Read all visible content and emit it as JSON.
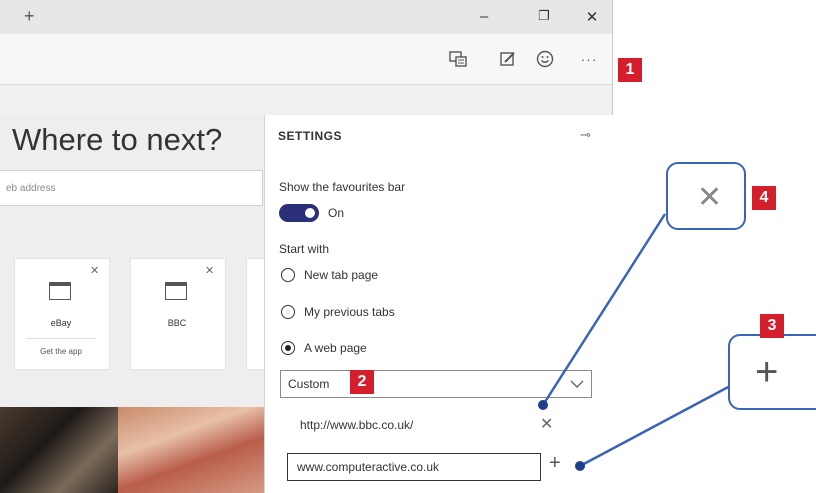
{
  "window": {
    "title_add": "+",
    "controls": {
      "minimize": "–",
      "restore": "❐",
      "close": "✕"
    }
  },
  "toolbar": {
    "icons": [
      "reading-view-icon",
      "web-note-icon",
      "feedback-icon",
      "more-icon"
    ],
    "more_label": "···"
  },
  "newtab": {
    "heading": "Where to next?",
    "address_placeholder": "eb address",
    "tiles": [
      {
        "label": "eBay",
        "sub": "Get the app"
      },
      {
        "label": "BBC"
      }
    ]
  },
  "settings": {
    "title": "SETTINGS",
    "favourites_label": "Show the favourites bar",
    "favourites_state": "On",
    "start_with_label": "Start with",
    "options": [
      "New tab page",
      "My previous tabs",
      "A web page"
    ],
    "selected_option": "A web page",
    "dropdown_value": "Custom",
    "pages": [
      "http://www.bbc.co.uk/"
    ],
    "new_page_value": "www.computeractive.co.uk"
  },
  "callouts": [
    "1",
    "2",
    "3",
    "4"
  ],
  "colors": {
    "accent_toggle": "#2b2f7a",
    "badge": "#d41e2b",
    "callout_line": "#3a64b8"
  }
}
